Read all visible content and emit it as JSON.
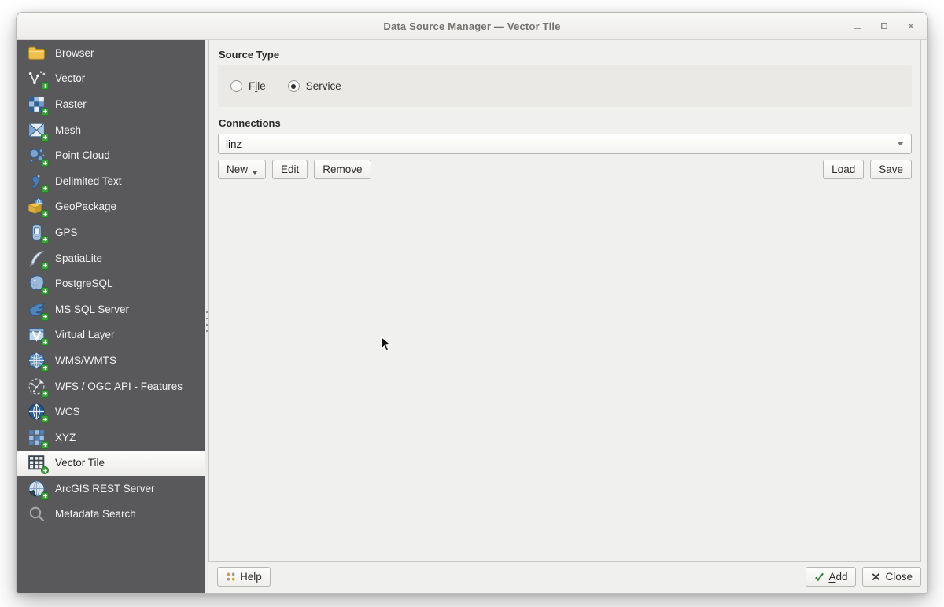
{
  "window": {
    "title": "Data Source Manager — Vector Tile"
  },
  "sidebar": {
    "items": [
      {
        "label": "Browser"
      },
      {
        "label": "Vector"
      },
      {
        "label": "Raster"
      },
      {
        "label": "Mesh"
      },
      {
        "label": "Point Cloud"
      },
      {
        "label": "Delimited Text"
      },
      {
        "label": "GeoPackage"
      },
      {
        "label": "GPS"
      },
      {
        "label": "SpatiaLite"
      },
      {
        "label": "PostgreSQL"
      },
      {
        "label": "MS SQL Server"
      },
      {
        "label": "Virtual Layer"
      },
      {
        "label": "WMS/WMTS"
      },
      {
        "label": "WFS / OGC API - Features"
      },
      {
        "label": "WCS"
      },
      {
        "label": "XYZ"
      },
      {
        "label": "Vector Tile",
        "selected": true
      },
      {
        "label": "ArcGIS REST Server"
      },
      {
        "label": "Metadata Search"
      }
    ]
  },
  "main": {
    "source_type": {
      "title": "Source Type",
      "file_radio": {
        "pre": "F",
        "mnemonic": "i",
        "post": "le",
        "selected": false
      },
      "service_radio": {
        "label": "Service",
        "selected": true
      }
    },
    "connections": {
      "title": "Connections",
      "combo_value": "linz",
      "new_button": {
        "mnemonic": "N",
        "post": "ew"
      },
      "edit_button": "Edit",
      "remove_button": "Remove",
      "load_button": "Load",
      "save_button": "Save"
    }
  },
  "footer": {
    "help_button": "Help",
    "add_button": {
      "mnemonic": "A",
      "post": "dd"
    },
    "close_button": "Close"
  },
  "colors": {
    "sidebar_bg": "#59595b",
    "selected_item_bg": "#f6f5f3",
    "panel_bg": "#f0f0ee",
    "groupbox_bg": "#eae9e6",
    "plus_badge_green": "#3aa33a",
    "add_check_green": "#2f7d32"
  }
}
